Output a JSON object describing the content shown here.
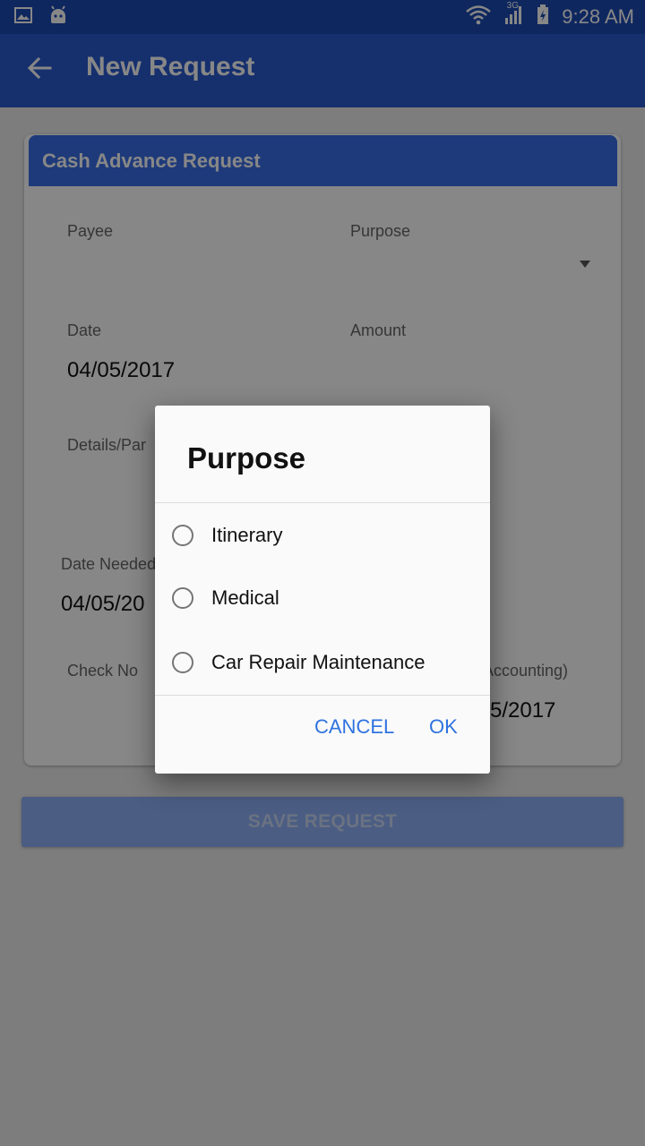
{
  "status_bar": {
    "time": "9:28 AM",
    "network": "3G"
  },
  "toolbar": {
    "title": "New Request"
  },
  "card": {
    "title": "Cash Advance Request",
    "fields": {
      "payee_label": "Payee",
      "purpose_label": "Purpose",
      "date_label": "Date",
      "date_value": "04/05/2017",
      "amount_label": "Amount",
      "details_label": "Details/Par",
      "date_needed_label": "Date Needed",
      "date_needed_value": "04/05/20",
      "check_no_label": "Check No",
      "accounting_label": "Accounting)",
      "accounting_value": "5/2017"
    }
  },
  "save_button_label": "SAVE REQUEST",
  "dialog": {
    "title": "Purpose",
    "options": [
      "Itinerary",
      "Medical",
      "Car Repair Maintenance"
    ],
    "cancel_label": "CANCEL",
    "ok_label": "OK"
  },
  "colors": {
    "status_bar": "#1e4bb4",
    "toolbar": "#2a5bd0",
    "card_header": "#3a6fe6",
    "accent": "#2f73e0"
  }
}
